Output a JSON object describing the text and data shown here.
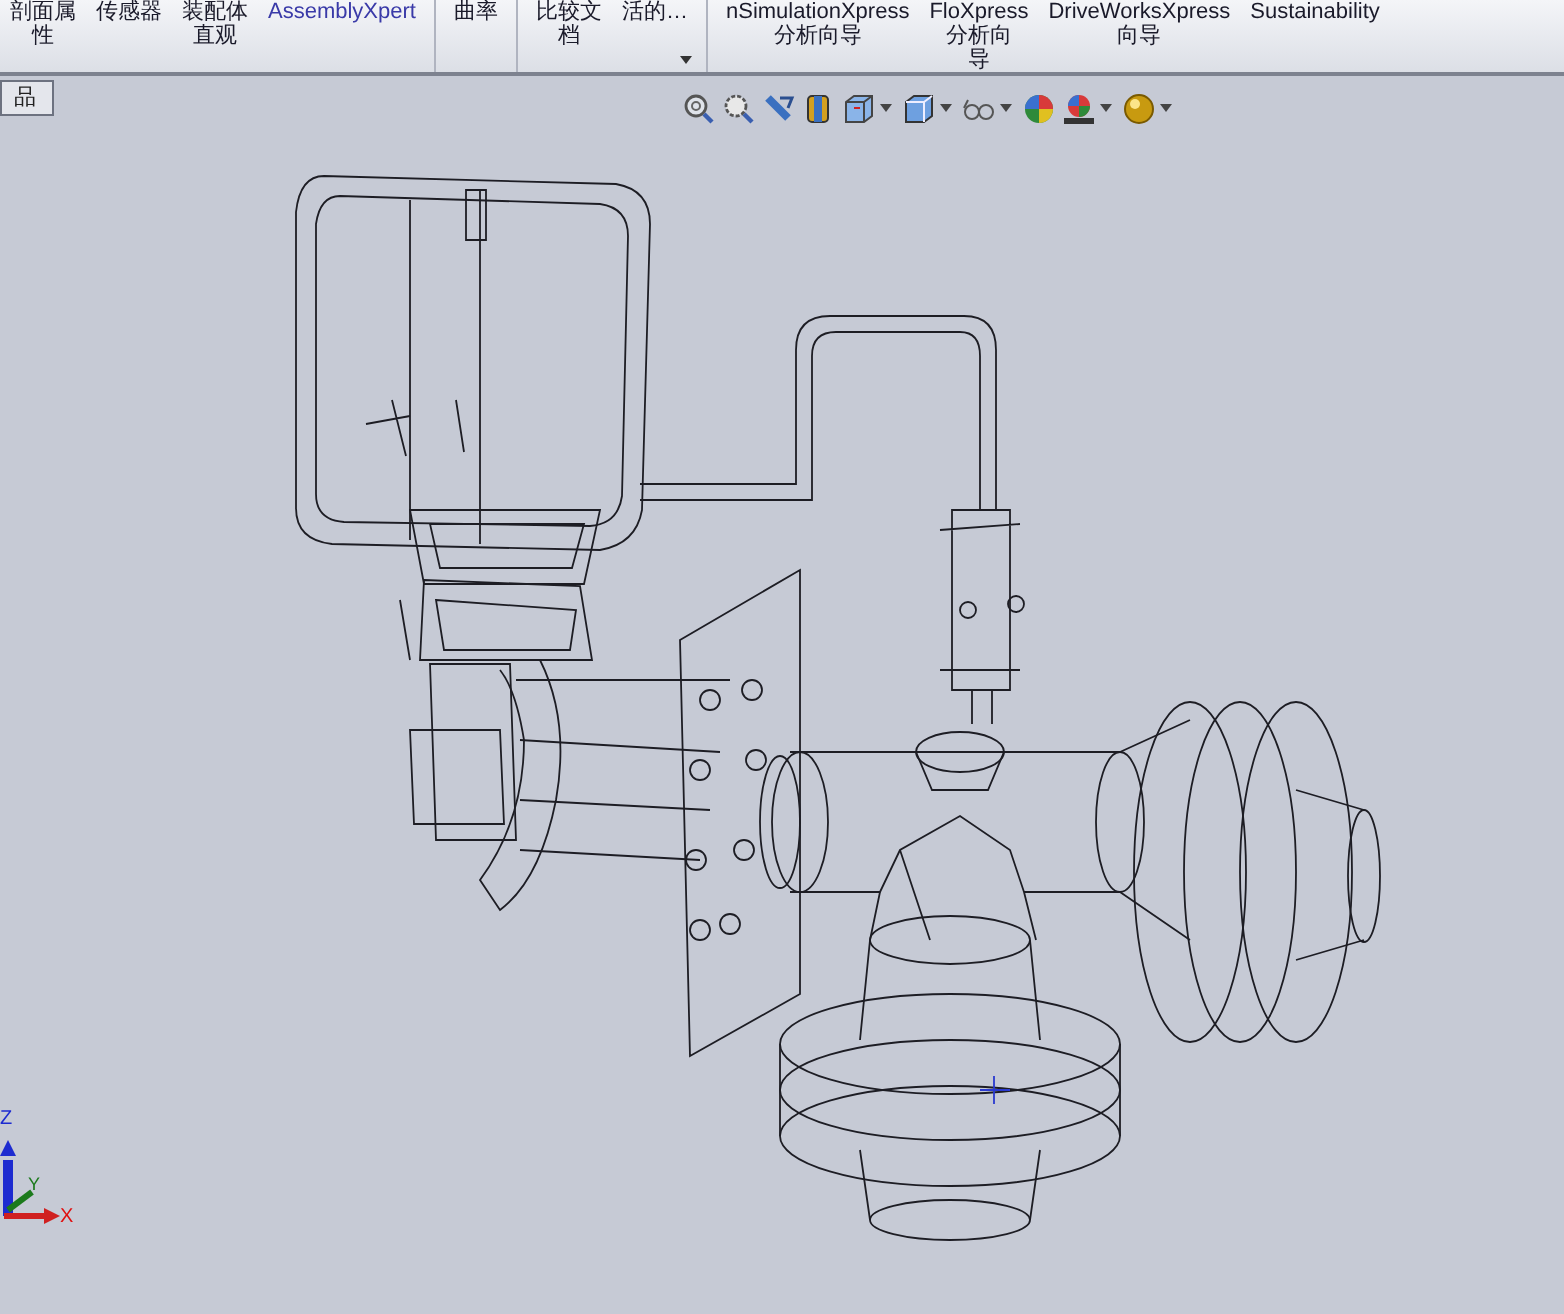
{
  "ribbon": {
    "buttons": [
      {
        "lines": [
          "剖面属",
          "性"
        ],
        "separator_before": false,
        "has_menu": false,
        "link_style": false
      },
      {
        "lines": [
          "传感器"
        ],
        "separator_before": false,
        "has_menu": false,
        "link_style": false
      },
      {
        "lines": [
          "装配体",
          "直观"
        ],
        "separator_before": false,
        "has_menu": false,
        "link_style": false
      },
      {
        "lines": [
          "AssemblyXpert"
        ],
        "separator_before": false,
        "has_menu": false,
        "link_style": true
      },
      {
        "lines": [
          "曲率"
        ],
        "separator_before": true,
        "has_menu": false,
        "link_style": false
      },
      {
        "lines": [
          "比较文",
          "档"
        ],
        "separator_before": true,
        "has_menu": false,
        "link_style": false
      },
      {
        "lines": [
          "活的…"
        ],
        "separator_before": false,
        "has_menu": true,
        "link_style": false
      },
      {
        "lines": [
          "nSimulationXpress",
          "分析向导"
        ],
        "separator_before": true,
        "has_menu": false,
        "link_style": false
      },
      {
        "lines": [
          "FloXpress",
          "分析向",
          "导"
        ],
        "separator_before": false,
        "has_menu": false,
        "link_style": false
      },
      {
        "lines": [
          "DriveWorksXpress",
          "向导"
        ],
        "separator_before": false,
        "has_menu": false,
        "link_style": false
      },
      {
        "lines": [
          "Sustainability"
        ],
        "separator_before": false,
        "has_menu": false,
        "link_style": false
      }
    ]
  },
  "tabs": [
    {
      "label": "品",
      "selected": true
    }
  ],
  "view_toolbar": [
    {
      "kind": "zoom-fit",
      "has_menu": false
    },
    {
      "kind": "zoom-area",
      "has_menu": false
    },
    {
      "kind": "previous-view",
      "has_menu": false
    },
    {
      "kind": "section-view",
      "has_menu": false
    },
    {
      "kind": "view-orientation",
      "has_menu": true
    },
    {
      "kind": "display-style",
      "has_menu": true
    },
    {
      "kind": "hide-show",
      "has_menu": true
    },
    {
      "kind": "appearance",
      "has_menu": false
    },
    {
      "kind": "scene",
      "has_menu": true
    },
    {
      "kind": "view-settings",
      "has_menu": true
    }
  ],
  "triad": {
    "z_label": "Z",
    "y_label": "Y",
    "x_label": "X"
  }
}
